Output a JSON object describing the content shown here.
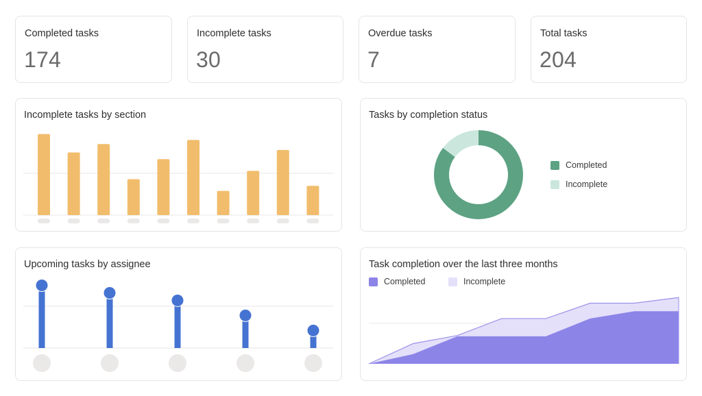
{
  "stats": [
    {
      "label": "Completed tasks",
      "value": "174"
    },
    {
      "label": "Incomplete tasks",
      "value": "30"
    },
    {
      "label": "Overdue tasks",
      "value": "7"
    },
    {
      "label": "Total tasks",
      "value": "204"
    }
  ],
  "colors": {
    "bar": "#f1bd6c",
    "lollipop": "#4573d2",
    "completed_green": "#5da283",
    "incomplete_green": "#cbe7dd",
    "completed_purple": "#8d84e8",
    "incomplete_purple": "#e4e0fa",
    "line_purple": "#9a91ea",
    "gridline": "#e8e6e6",
    "placeholder": "#ebe8e8"
  },
  "chart_data": [
    {
      "type": "bar",
      "title": "Incomplete tasks by section",
      "categories": [
        "",
        "",
        "",
        "",
        "",
        "",
        "",
        "",
        "",
        ""
      ],
      "values": [
        9.7,
        7.5,
        8.5,
        4.3,
        6.7,
        9.0,
        2.9,
        5.3,
        7.8,
        3.5
      ],
      "ylim": [
        0,
        10
      ],
      "gridlines": [
        0,
        5
      ],
      "xlabel": "",
      "ylabel": "",
      "grid": true,
      "tick_labels_hidden": true
    },
    {
      "type": "pie",
      "donut": true,
      "title": "Tasks by completion status",
      "labels": [
        "Completed",
        "Incomplete"
      ],
      "values": [
        174,
        30
      ],
      "legend": "right"
    },
    {
      "type": "bar",
      "style": "lollipop",
      "title": "Upcoming tasks by assignee",
      "categories": [
        "",
        "",
        "",
        "",
        ""
      ],
      "values": [
        7.5,
        6.6,
        5.7,
        3.9,
        2.1
      ],
      "ylim": [
        0,
        10
      ],
      "gridlines": [
        0,
        5
      ],
      "xlabel": "",
      "ylabel": "",
      "grid": true,
      "tick_labels_hidden": true
    },
    {
      "type": "area",
      "stacked": false,
      "title": "Task completion over the last three months",
      "x": [
        0,
        1,
        2,
        3,
        4,
        5,
        6,
        7
      ],
      "series": [
        {
          "name": "Completed",
          "values": [
            0,
            1.2,
            3.4,
            3.4,
            3.4,
            5.6,
            6.5,
            6.5
          ]
        },
        {
          "name": "Incomplete",
          "values": [
            0,
            2.5,
            3.5,
            5.6,
            5.6,
            7.5,
            7.5,
            8.2
          ]
        }
      ],
      "ylim": [
        0,
        10
      ],
      "gridlines": [
        0,
        5
      ],
      "legend": "top-left",
      "xlabel": "",
      "ylabel": "",
      "grid": true
    }
  ]
}
